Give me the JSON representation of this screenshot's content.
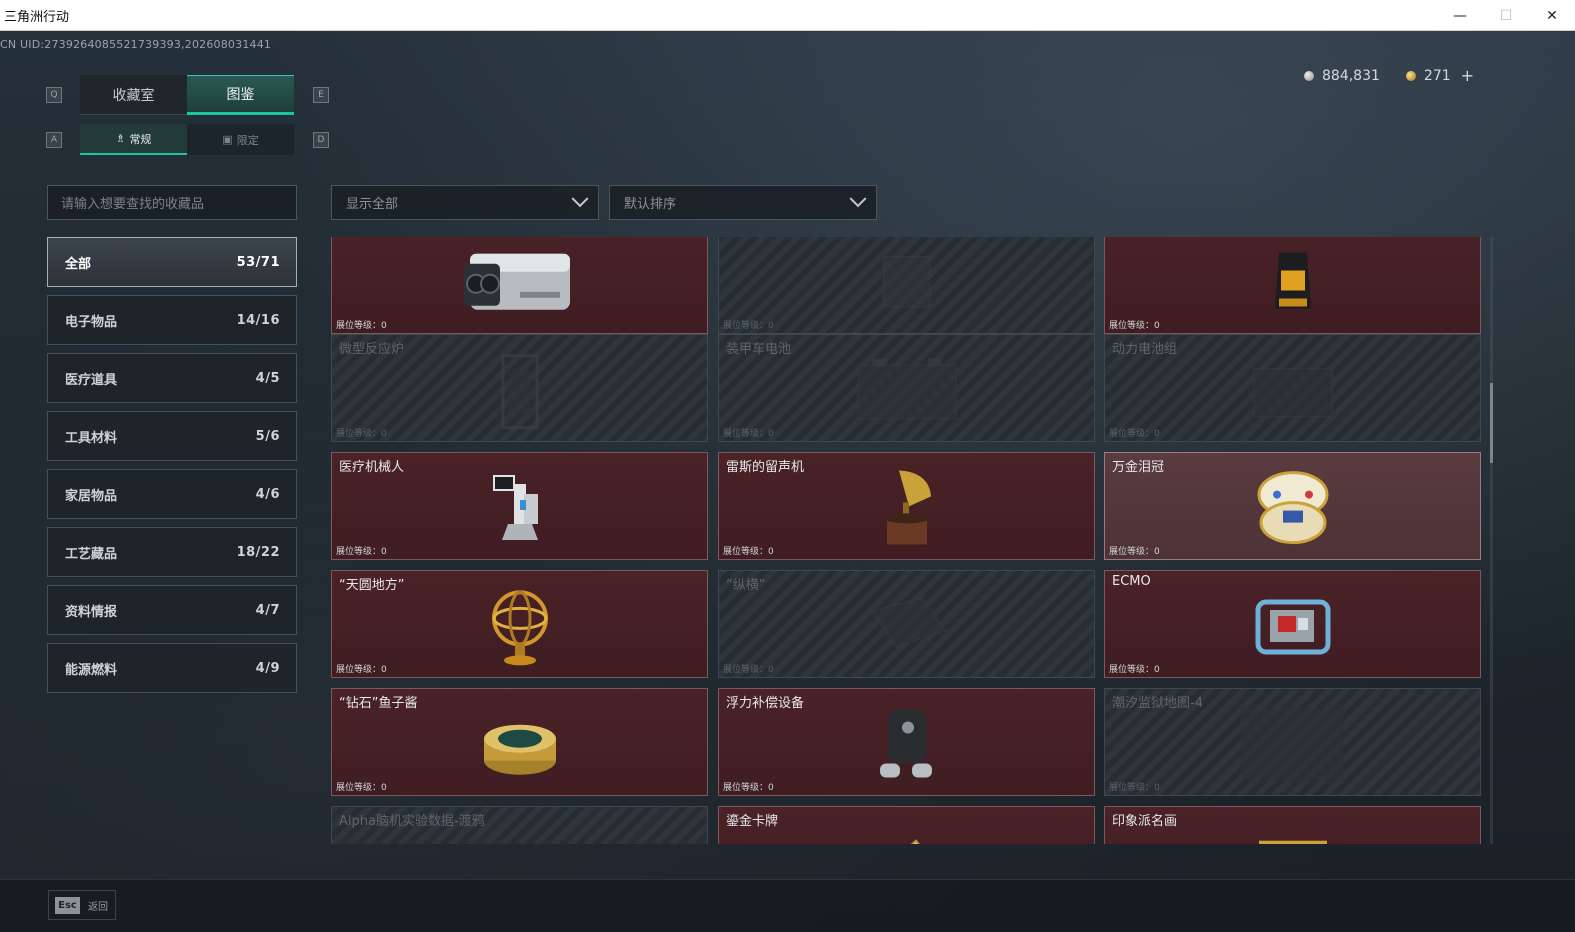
{
  "window": {
    "title": "三角洲行动",
    "minimize": "—",
    "maximize": "☐",
    "close": "✕"
  },
  "uid": "CN UID:2739264085521739393,202608031441",
  "currency": {
    "silver": "884,831",
    "gold": "271",
    "add": "+"
  },
  "keys": {
    "q": "Q",
    "e": "E",
    "a": "A",
    "d": "D"
  },
  "tabs": [
    {
      "label": "收藏室",
      "active": false
    },
    {
      "label": "图鉴",
      "active": true
    }
  ],
  "subtabs": [
    {
      "label": "常规",
      "icon": "♗",
      "active": true
    },
    {
      "label": "限定",
      "icon": "▣",
      "active": false
    }
  ],
  "search": {
    "placeholder": "请输入想要查找的收藏品"
  },
  "filters": {
    "display": "显示全部",
    "sort": "默认排序"
  },
  "categories": [
    {
      "label": "全部",
      "count": "53/71",
      "active": true
    },
    {
      "label": "电子物品",
      "count": "14/16"
    },
    {
      "label": "医疗道具",
      "count": "4/5"
    },
    {
      "label": "工具材料",
      "count": "5/6"
    },
    {
      "label": "家居物品",
      "count": "4/6"
    },
    {
      "label": "工艺藏品",
      "count": "18/22"
    },
    {
      "label": "资料情报",
      "count": "4/7"
    },
    {
      "label": "能源燃料",
      "count": "4/9"
    }
  ],
  "level_label": "展位等级：",
  "level_value": "0",
  "cards": [
    {
      "name": "",
      "owned": true,
      "icon": "camera-device-icon"
    },
    {
      "name": "",
      "owned": false,
      "icon": "device-icon"
    },
    {
      "name": "",
      "owned": true,
      "icon": "coffee-bag-icon"
    },
    {
      "name": "微型反应炉",
      "owned": false,
      "icon": "reactor-icon"
    },
    {
      "name": "装甲车电池",
      "owned": false,
      "icon": "battery-icon"
    },
    {
      "name": "动力电池组",
      "owned": false,
      "icon": "battery-pack-icon"
    },
    {
      "name": "医疗机械人",
      "owned": true,
      "icon": "medical-robot-icon"
    },
    {
      "name": "雷斯的留声机",
      "owned": true,
      "icon": "gramophone-icon"
    },
    {
      "name": "万金泪冠",
      "owned": true,
      "light": true,
      "icon": "jeweled-egg-icon"
    },
    {
      "name": "“天圆地方”",
      "owned": true,
      "icon": "armillary-sphere-icon"
    },
    {
      "name": "“纵横”",
      "owned": false,
      "icon": "chess-board-icon"
    },
    {
      "name": "ECMO",
      "owned": true,
      "icon": "ecmo-machine-icon"
    },
    {
      "name": "“钻石”鱼子酱",
      "owned": true,
      "icon": "caviar-tin-icon"
    },
    {
      "name": "浮力补偿设备",
      "owned": true,
      "icon": "buoyancy-device-icon"
    },
    {
      "name": "潮汐监狱地图-4",
      "owned": false,
      "icon": "map-icon"
    },
    {
      "name": "Alpha脑机实验数据-渡鸦",
      "owned": false,
      "icon": "data-icon"
    },
    {
      "name": "鎏金卡牌",
      "owned": true,
      "icon": "gold-card-icon"
    },
    {
      "name": "印象派名画",
      "owned": true,
      "icon": "painting-icon"
    }
  ],
  "bottom": {
    "esc_key": "Esc",
    "back": "返回"
  },
  "colors": {
    "accent": "#16c7a0",
    "owned_card": "#4a2227",
    "missing_card": "#262e34"
  }
}
